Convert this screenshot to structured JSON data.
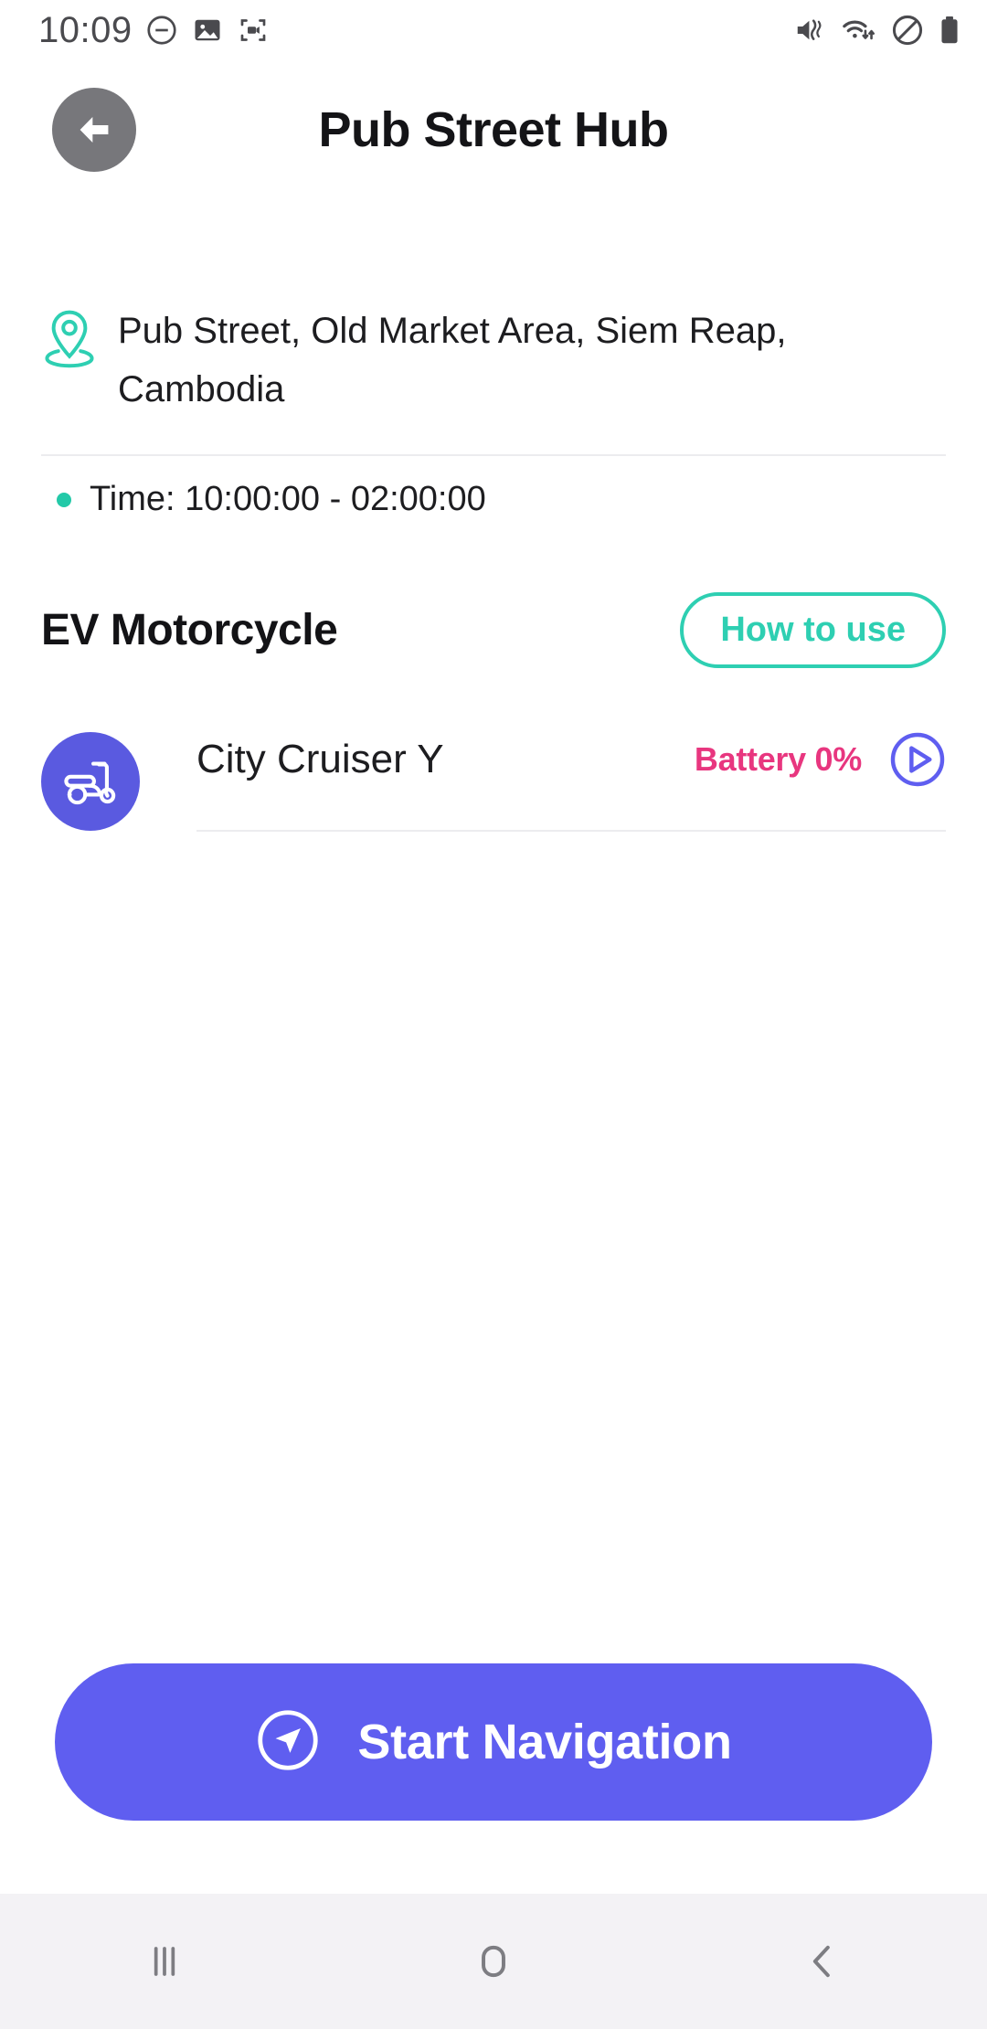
{
  "status_bar": {
    "time": "10:09",
    "left_icons": [
      "do-not-disturb-icon",
      "image-icon",
      "screen-record-icon"
    ],
    "right_icons": [
      "mute-vibrate-icon",
      "wifi-icon",
      "no-entry-icon",
      "battery-icon"
    ]
  },
  "header": {
    "back_icon": "arrow-left-icon",
    "title": "Pub Street Hub"
  },
  "location": {
    "pin_icon": "location-pin-icon",
    "address": "Pub Street, Old Market Area, Siem Reap, Cambodia",
    "time_label": "Time: 10:00:00 - 02:00:00"
  },
  "section": {
    "title": "EV Motorcycle",
    "how_to_use_label": "How to use"
  },
  "vehicles": [
    {
      "icon": "scooter-icon",
      "name": "City Cruiser Y",
      "battery": "Battery 0%",
      "action_icon": "play-circle-icon"
    }
  ],
  "cta": {
    "icon": "navigation-arrow-icon",
    "label": "Start Navigation"
  },
  "nav_bar": {
    "recents_icon": "recents-icon",
    "home_icon": "home-icon",
    "back_icon": "back-chevron-icon"
  },
  "colors": {
    "accent_teal": "#2ecfb2",
    "accent_purple": "#5f5ef0",
    "battery_pink": "#e8367f",
    "avatar_purple": "#5a5ae0",
    "back_gray": "#77777b"
  }
}
